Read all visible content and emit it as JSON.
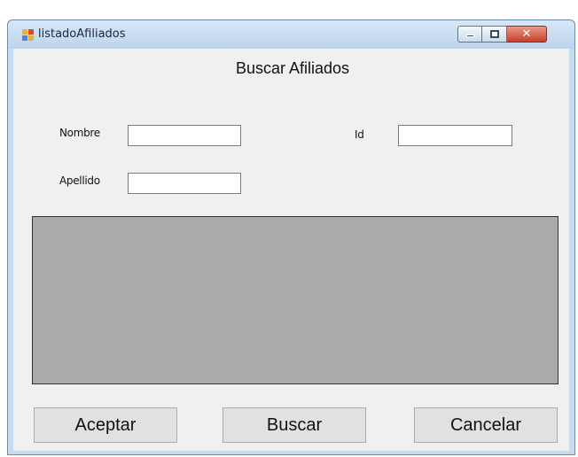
{
  "window": {
    "title": "listadoAfiliados",
    "close_symbol": "✕",
    "icons": {
      "app": "app-icon",
      "minimize": "minimize-icon",
      "maximize": "maximize-icon",
      "close": "close-icon"
    }
  },
  "form": {
    "heading": "Buscar Afiliados",
    "nombre_label": "Nombre",
    "nombre_value": "",
    "id_label": "Id",
    "id_value": "",
    "apellido_label": "Apellido",
    "apellido_value": ""
  },
  "buttons": {
    "aceptar": "Aceptar",
    "buscar": "Buscar",
    "cancelar": "Cancelar"
  },
  "colors": {
    "grid_background": "#ababab",
    "form_background": "#f0f0f0"
  }
}
